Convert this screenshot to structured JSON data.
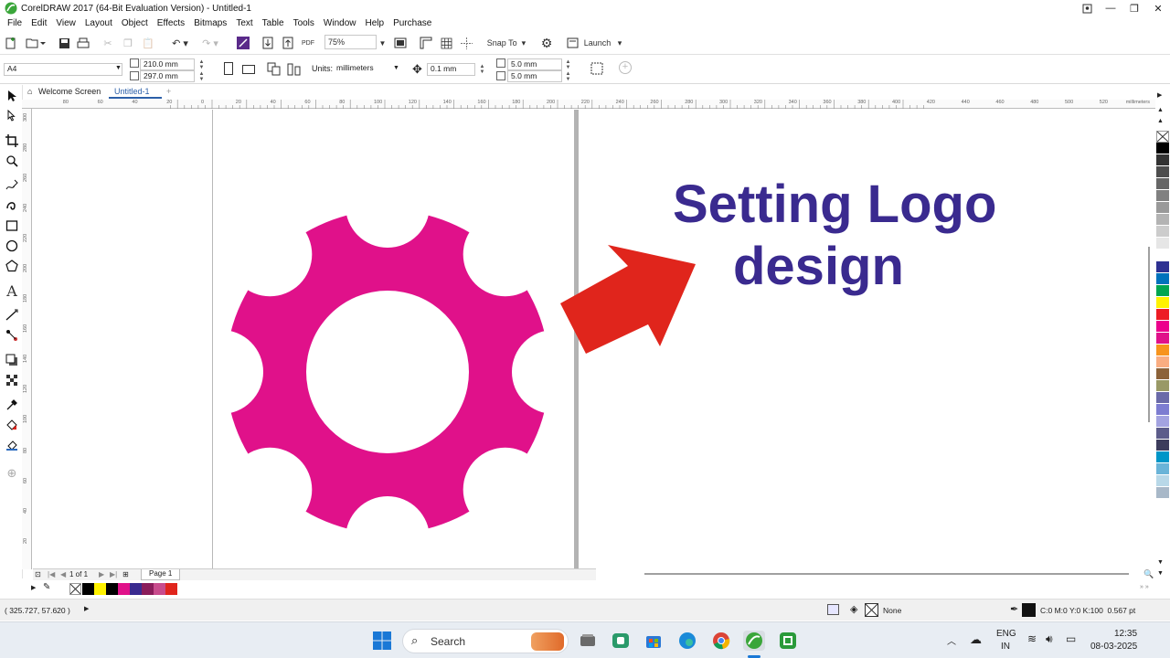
{
  "window": {
    "title": "CorelDRAW 2017 (64-Bit Evaluation Version) - Untitled-1",
    "controls": [
      "minimize-icon",
      "maximize-icon",
      "close-icon"
    ]
  },
  "menu": [
    "File",
    "Edit",
    "View",
    "Layout",
    "Object",
    "Effects",
    "Bitmaps",
    "Text",
    "Table",
    "Tools",
    "Window",
    "Help",
    "Purchase"
  ],
  "standard_toolbar": {
    "zoom": "75%",
    "snap_label": "Snap To",
    "launch_label": "Launch",
    "pdf_label": "PDF"
  },
  "property_bar": {
    "page_size": "A4",
    "width": "210.0 mm",
    "height": "297.0 mm",
    "units_label": "Units:",
    "units": "millimeters",
    "nudge": "0.1 mm",
    "dup_x": "5.0 mm",
    "dup_y": "5.0 mm"
  },
  "tabs": {
    "welcome": "Welcome Screen",
    "doc": "Untitled-1"
  },
  "ruler": {
    "h_ticks": [
      "80",
      "60",
      "40",
      "20",
      "0",
      "20",
      "40",
      "60",
      "80",
      "100",
      "120",
      "140",
      "160",
      "180",
      "200",
      "220",
      "240",
      "260",
      "280",
      "300",
      "320",
      "340",
      "360",
      "380",
      "400",
      "420",
      "440",
      "460",
      "480",
      "500",
      "520"
    ],
    "unit": "millimeters",
    "v_ticks": [
      "300",
      "280",
      "260",
      "240",
      "220",
      "200",
      "180",
      "160",
      "140",
      "120",
      "100",
      "80",
      "60",
      "40",
      "20"
    ]
  },
  "canvas": {
    "heading_line1": "Setting Logo",
    "heading_line2": "design",
    "text_color": "#3a2a8f",
    "gear_color": "#e0118a",
    "arrow_color": "#e0251c"
  },
  "page_nav": {
    "page_count": "1 of 1",
    "page_tab": "Page 1"
  },
  "palette_colors": [
    "#000000",
    "#333333",
    "#4d4d4d",
    "#666666",
    "#808080",
    "#999999",
    "#b3b3b3",
    "#cccccc",
    "#e6e6e6",
    "#ffffff",
    "#2e3192",
    "#0072bc",
    "#00a651",
    "#fff200",
    "#ed1c24",
    "#ec008c",
    "#e0118a",
    "#f7941d",
    "#f9ad81",
    "#8c6239",
    "#999966",
    "#6a6aa8",
    "#7d7dd1",
    "#a3a3e0",
    "#5c5c8a",
    "#3d3d5c",
    "#0096c8",
    "#6ab4d8",
    "#b8d8e8",
    "#a8b8c8"
  ],
  "doc_palette": [
    "#000000",
    "#fff200",
    "#000000",
    "#e0118a",
    "#3a2a8f",
    "#8a1c5a",
    "#c84b8c",
    "#e0251c"
  ],
  "status": {
    "coords": "( 325.727, 57.620 )",
    "fill_label": "None",
    "outline_info": "C:0 M:0 Y:0 K:100  0.567 pt"
  },
  "taskbar": {
    "search": "Search",
    "lang1": "ENG",
    "lang2": "IN",
    "time": "12:35",
    "date": "08-03-2025"
  }
}
